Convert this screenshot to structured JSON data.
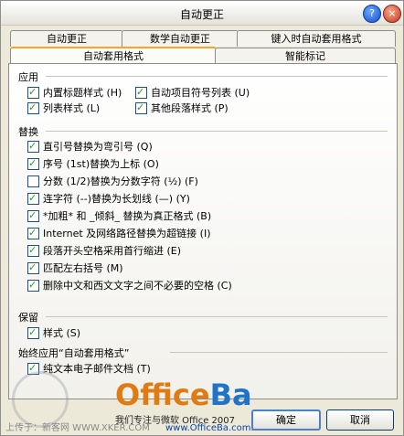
{
  "window": {
    "title": "自动更正",
    "help_label": "?",
    "close_label": "×"
  },
  "tabs": {
    "row1": [
      {
        "label": "自动更正"
      },
      {
        "label": "数学自动更正"
      },
      {
        "label": "键入时自动套用格式"
      }
    ],
    "row2": [
      {
        "label": "自动套用格式",
        "active": true
      },
      {
        "label": "智能标记"
      }
    ]
  },
  "apply": {
    "heading": "应用",
    "items": [
      {
        "label": "内置标题样式 (H)",
        "checked": true
      },
      {
        "label": "自动项目符号列表 (U)",
        "checked": true
      },
      {
        "label": "列表样式 (L)",
        "checked": true
      },
      {
        "label": "其他段落样式 (P)",
        "checked": true
      }
    ]
  },
  "replace": {
    "heading": "替换",
    "items": [
      {
        "label": "直引号替换为弯引号 (Q)",
        "checked": true
      },
      {
        "label": "序号 (1st)替换为上标 (O)",
        "checked": true
      },
      {
        "label": "分数 (1/2)替换为分数字符 (½) (F)",
        "checked": false
      },
      {
        "label": "连字符 (--)替换为长划线 (—) (Y)",
        "checked": true
      },
      {
        "label": "*加粗* 和 _倾斜_ 替换为真正格式 (B)",
        "checked": true
      },
      {
        "label": "Internet 及网络路径替换为超链接 (I)",
        "checked": true
      },
      {
        "label": "段落开头空格采用首行缩进 (E)",
        "checked": true
      },
      {
        "label": "匹配左右括号 (M)",
        "checked": true
      },
      {
        "label": "删除中文和西文文字之间不必要的空格 (C)",
        "checked": true
      }
    ]
  },
  "preserve": {
    "heading": "保留",
    "items": [
      {
        "label": "样式 (S)",
        "checked": true
      }
    ]
  },
  "always": {
    "heading": "始终应用“自动套用格式”",
    "items": [
      {
        "label": "纯文本电子邮件文档 (T)",
        "checked": true
      }
    ]
  },
  "buttons": {
    "ok": "确定",
    "cancel": "取消"
  },
  "watermark": {
    "logo_a": "Office",
    "logo_b": "Ba",
    "tagline": "我们专注与微软 Office 2007",
    "url": "www.OfficeBa.com.cn",
    "left_text": "上传于：新客网 WWW.XKER.COM"
  }
}
